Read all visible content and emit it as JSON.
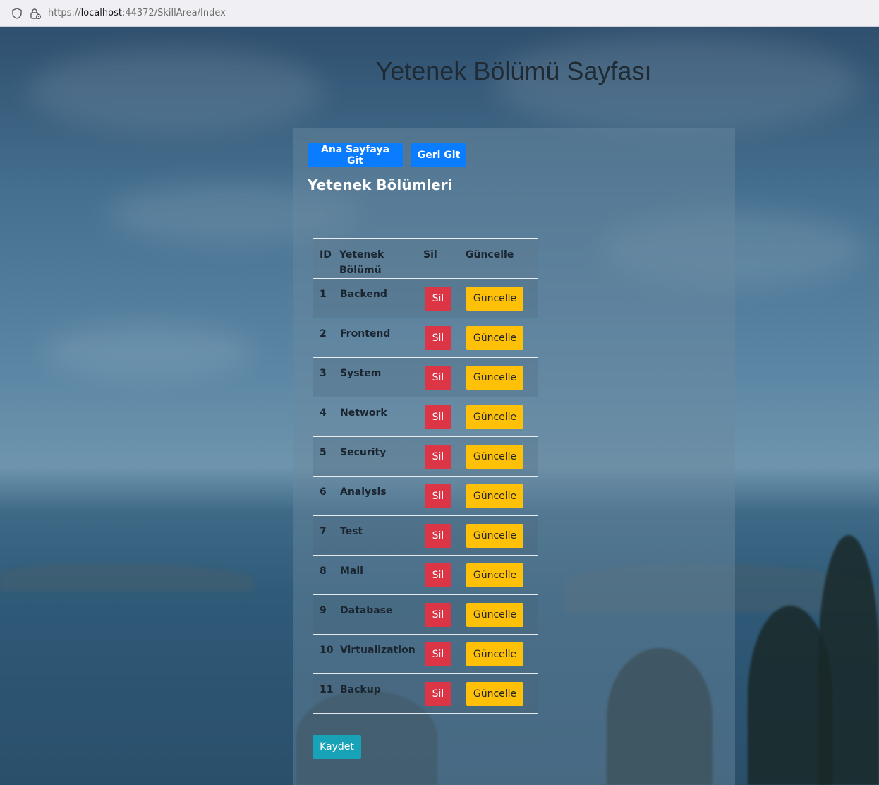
{
  "browser": {
    "url_scheme": "https://",
    "url_host": "localhost",
    "url_rest": ":44372/SkillArea/Index"
  },
  "page": {
    "title": "Yetenek Bölümü Sayfası"
  },
  "nav": {
    "home_button": "Ana Sayfaya Git",
    "back_button": "Geri Git"
  },
  "section": {
    "title": "Yetenek Bölümleri"
  },
  "table": {
    "headers": {
      "id": "ID",
      "name": "Yetenek Bölümü",
      "delete": "Sil",
      "update": "Güncelle"
    },
    "rows": [
      {
        "id": "1",
        "name": "Backend",
        "delete": "Sil",
        "update": "Güncelle"
      },
      {
        "id": "2",
        "name": "Frontend",
        "delete": "Sil",
        "update": "Güncelle"
      },
      {
        "id": "3",
        "name": "System",
        "delete": "Sil",
        "update": "Güncelle"
      },
      {
        "id": "4",
        "name": "Network",
        "delete": "Sil",
        "update": "Güncelle"
      },
      {
        "id": "5",
        "name": "Security",
        "delete": "Sil",
        "update": "Güncelle"
      },
      {
        "id": "6",
        "name": "Analysis",
        "delete": "Sil",
        "update": "Güncelle"
      },
      {
        "id": "7",
        "name": "Test",
        "delete": "Sil",
        "update": "Güncelle"
      },
      {
        "id": "8",
        "name": "Mail",
        "delete": "Sil",
        "update": "Güncelle"
      },
      {
        "id": "9",
        "name": "Database",
        "delete": "Sil",
        "update": "Güncelle"
      },
      {
        "id": "10",
        "name": "Virtualization",
        "delete": "Sil",
        "update": "Güncelle"
      },
      {
        "id": "11",
        "name": "Backup",
        "delete": "Sil",
        "update": "Güncelle"
      }
    ]
  },
  "actions": {
    "save_button": "Kaydet"
  },
  "colors": {
    "primary": "#0a7cff",
    "danger": "#dc3545",
    "warning": "#ffc107",
    "info": "#17a2b8"
  },
  "icons": [
    "shield-icon",
    "lock-icon"
  ]
}
